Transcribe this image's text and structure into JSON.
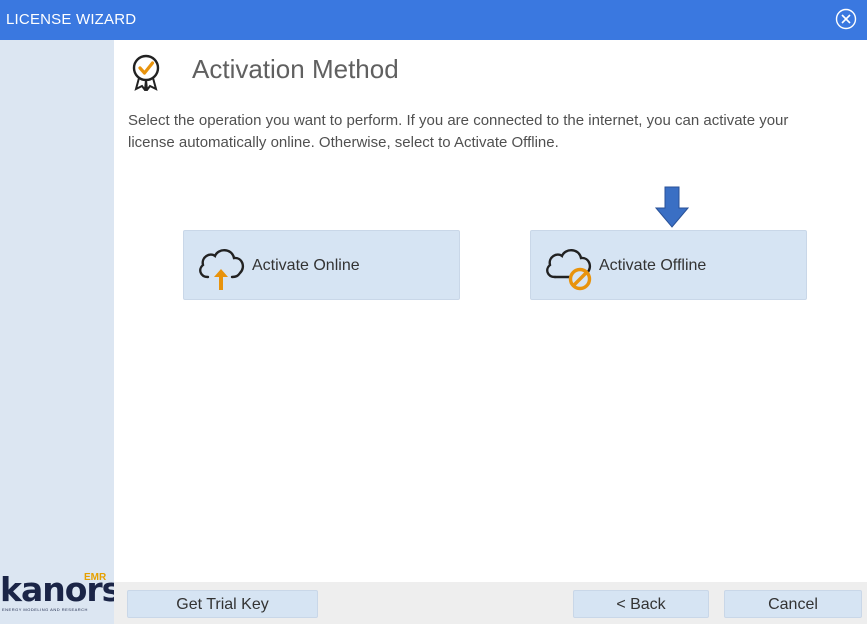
{
  "window": {
    "title": "LICENSE WIZARD",
    "close_icon": "circle-x-icon"
  },
  "brand": {
    "name": "kanors",
    "badge": "EMR",
    "tagline": "ENERGY MODELING AND RESEARCH"
  },
  "page": {
    "title": "Activation Method",
    "title_icon": "award-check-icon",
    "description": "Select the operation you want to perform. If you are connected to the internet, you can activate your license automatically online. Otherwise, select to Activate Offline."
  },
  "options": [
    {
      "label": "Activate Online",
      "icon": "cloud-upload-icon"
    },
    {
      "label": "Activate Offline",
      "icon": "cloud-blocked-icon"
    }
  ],
  "footer": {
    "trial_label": "Get Trial Key",
    "back_label": "< Back",
    "cancel_label": "Cancel"
  },
  "colors": {
    "titlebar": "#3a78e0",
    "sidebar": "#dce6f2",
    "button": "#d6e4f3",
    "accent_orange": "#e8930c",
    "pointer_arrow": "#3a6fc4"
  }
}
